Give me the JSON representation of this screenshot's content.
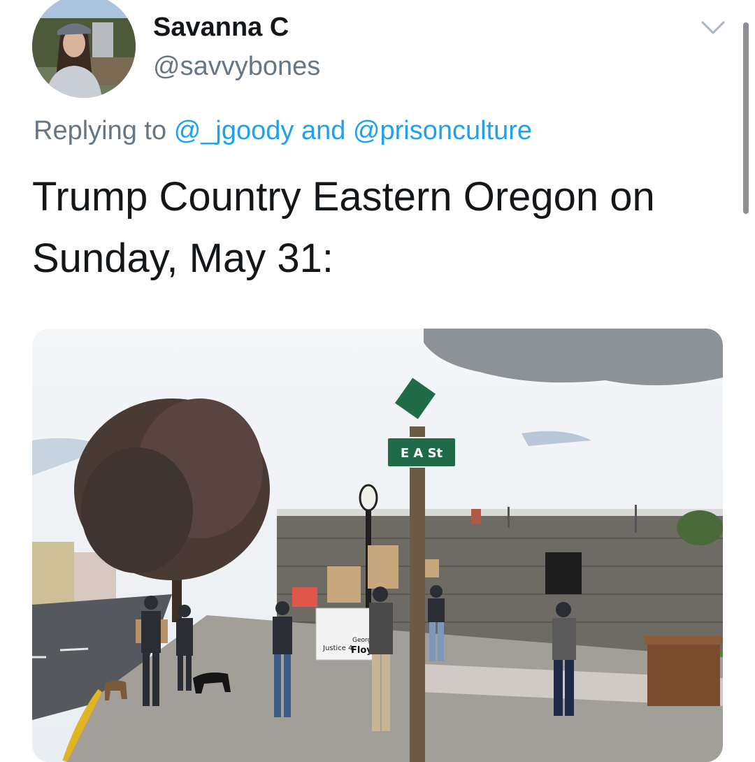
{
  "tweet": {
    "author": {
      "name": "Savanna C",
      "handle": "@savvybones",
      "avatar_icon": "profile-photo"
    },
    "reply": {
      "prefix": "Replying to",
      "mention_1": "@_jgoody",
      "joiner": "and",
      "mention_2": "@prisonculture"
    },
    "text": "Trump Country Eastern Oregon on Sunday, May 31:",
    "menu_icon": "chevron-down-icon"
  },
  "photo": {
    "street_sign": "E A St",
    "signs": {
      "sign_justice": "Justice 4",
      "sign_george": "George",
      "sign_floyd": "Floyd!"
    }
  },
  "colors": {
    "text_primary": "#14171a",
    "text_secondary": "#657786",
    "link": "#1da1f2",
    "street_sign_green": "#1f6b47"
  }
}
